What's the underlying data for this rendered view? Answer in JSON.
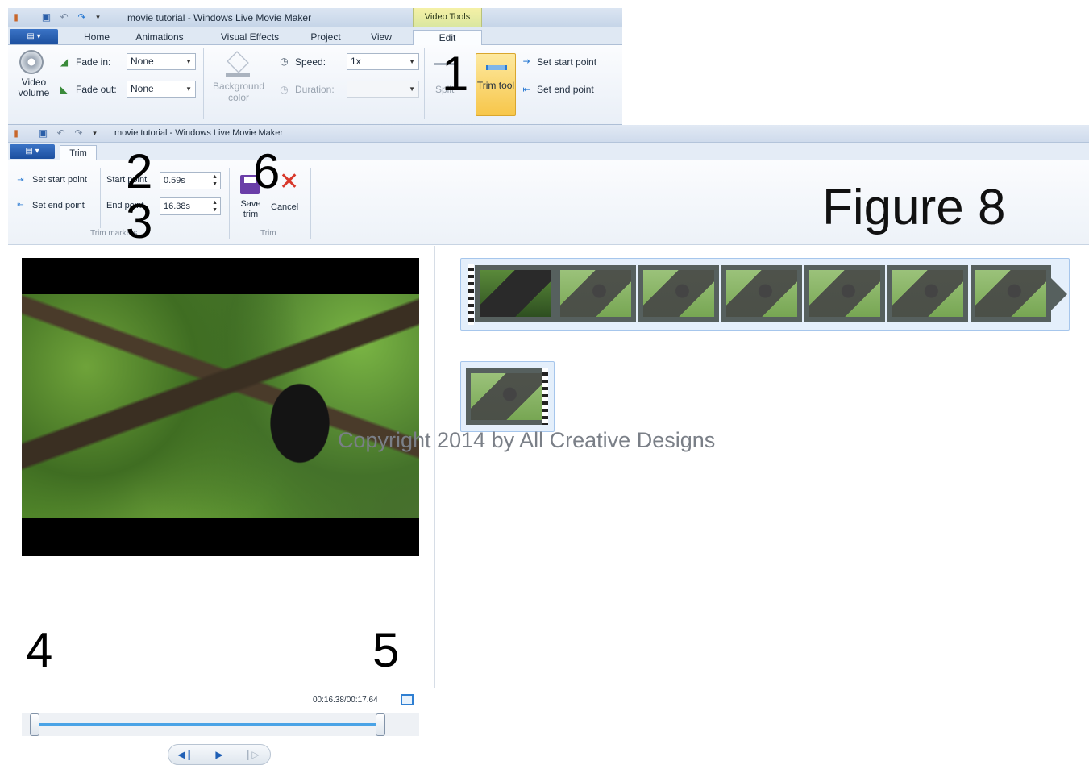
{
  "edit_window": {
    "title": "movie tutorial - Windows Live Movie Maker",
    "context_tab": "Video Tools",
    "tabs": [
      "Home",
      "Animations",
      "Visual Effects",
      "Project",
      "View",
      "Edit"
    ],
    "active_tab": "Edit",
    "video_volume_label": "Video volume",
    "fade_in_label": "Fade in:",
    "fade_in_value": "None",
    "fade_out_label": "Fade out:",
    "fade_out_value": "None",
    "background_color_label": "Background color",
    "speed_label": "Speed:",
    "speed_value": "1x",
    "duration_label": "Duration:",
    "duration_value": "",
    "split_label": "Split",
    "trim_tool_label": "Trim tool",
    "set_start_point": "Set start point",
    "set_end_point": "Set end point"
  },
  "trim_window": {
    "title": "movie tutorial - Windows Live Movie Maker",
    "tab": "Trim",
    "set_start_point": "Set start point",
    "set_end_point": "Set end point",
    "start_point_label": "Start point",
    "start_point_value": "0.59s",
    "end_point_label": "End point",
    "end_point_value": "16.38s",
    "group_trim_markers": "Trim markers",
    "save_trim_label": "Save trim",
    "cancel_label": "Cancel",
    "group_trim": "Trim"
  },
  "preview": {
    "timecode": "00:16.38/00:17.64",
    "trim_start_fraction": 0.0,
    "trim_end_fraction": 0.93
  },
  "callouts": {
    "n1": "1",
    "n2": "2",
    "n3": "3",
    "n4": "4",
    "n5": "5",
    "n6": "6"
  },
  "figure_label": "Figure 8",
  "watermark": "Copyright 2014 by All Creative Designs",
  "colors": {
    "accent_blue": "#2f7fd2",
    "context_tab_yellow": "#f5f1a6",
    "slider_blue": "#4aa3e6"
  }
}
